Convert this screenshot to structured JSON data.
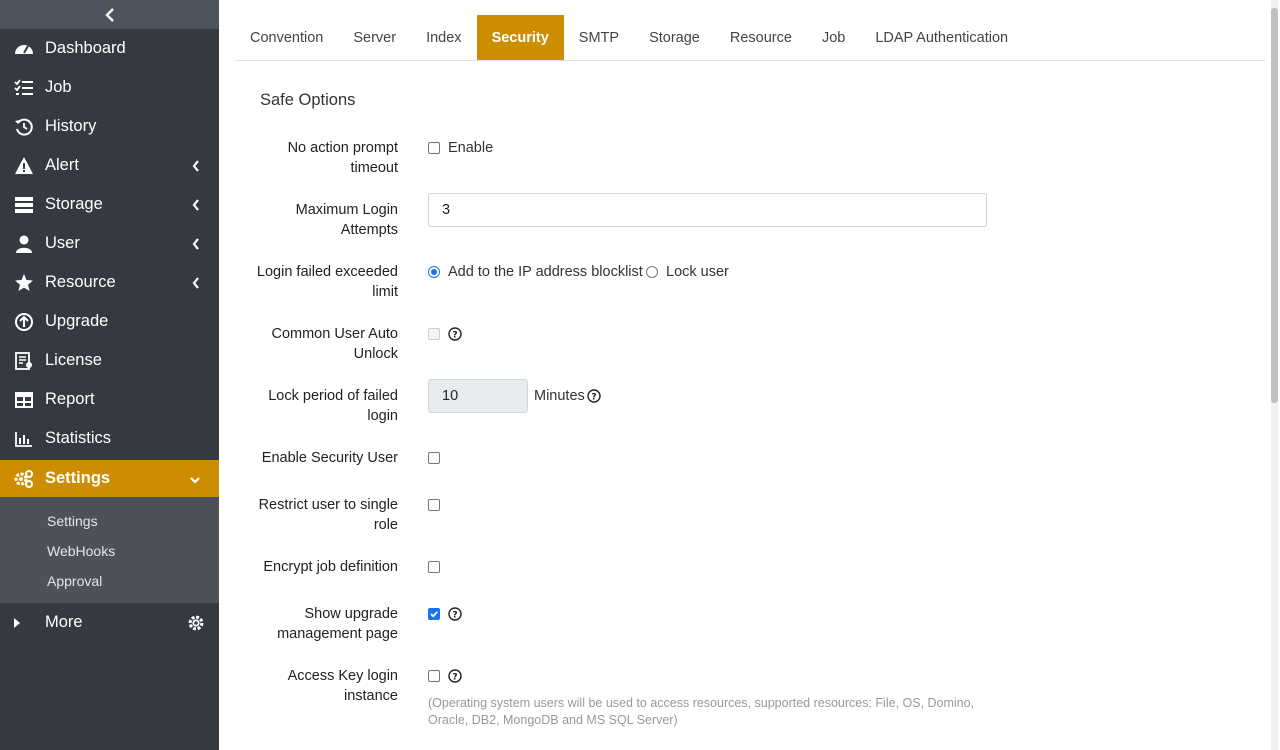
{
  "sidebar": {
    "items": [
      {
        "label": "Dashboard",
        "icon": "gauge-icon"
      },
      {
        "label": "Job",
        "icon": "task-list-icon"
      },
      {
        "label": "History",
        "icon": "history-icon"
      },
      {
        "label": "Alert",
        "icon": "warning-icon"
      },
      {
        "label": "Storage",
        "icon": "database-icon"
      },
      {
        "label": "User",
        "icon": "user-icon"
      },
      {
        "label": "Resource",
        "icon": "star-icon"
      },
      {
        "label": "Upgrade",
        "icon": "upgrade-icon"
      },
      {
        "label": "License",
        "icon": "license-icon"
      },
      {
        "label": "Report",
        "icon": "table-icon"
      },
      {
        "label": "Statistics",
        "icon": "bar-chart-icon"
      },
      {
        "label": "Settings",
        "icon": "cogs-icon"
      }
    ],
    "submenu": [
      "Settings",
      "WebHooks",
      "Approval"
    ],
    "more_label": "More"
  },
  "tabs": [
    "Convention",
    "Server",
    "Index",
    "Security",
    "SMTP",
    "Storage",
    "Resource",
    "Job",
    "LDAP Authentication"
  ],
  "active_tab": "Security",
  "section_title": "Safe Options",
  "form": {
    "no_action_label_1": "No action prompt",
    "no_action_label_2": "timeout",
    "no_action_enable": "Enable",
    "max_login_label_1": "Maximum Login",
    "max_login_label_2": "Attempts",
    "max_login_value": "3",
    "login_failed_label_1": "Login failed exceeded",
    "login_failed_label_2": "limit",
    "login_failed_opt1": "Add to the IP address blocklist",
    "login_failed_opt2": "Lock user",
    "auto_unlock_label_1": "Common User Auto",
    "auto_unlock_label_2": "Unlock",
    "lock_period_label_1": "Lock period of failed",
    "lock_period_label_2": "login",
    "lock_period_value": "10",
    "lock_period_unit": "Minutes",
    "security_user_label": "Enable Security User",
    "single_role_label_1": "Restrict user to single",
    "single_role_label_2": "role",
    "encrypt_label": "Encrypt job definition",
    "upgrade_page_label_1": "Show upgrade",
    "upgrade_page_label_2": "management page",
    "access_key_label_1": "Access Key login",
    "access_key_label_2": "instance",
    "access_key_note_1": "(Operating system users will be used to access resources, supported resources: File, OS, Domino,",
    "access_key_note_2": "Oracle, DB2, MongoDB and MS SQL Server)"
  },
  "colors": {
    "accent": "#cc8e00",
    "sidebar": "#343a40",
    "checkbox": "#1a73e8"
  }
}
